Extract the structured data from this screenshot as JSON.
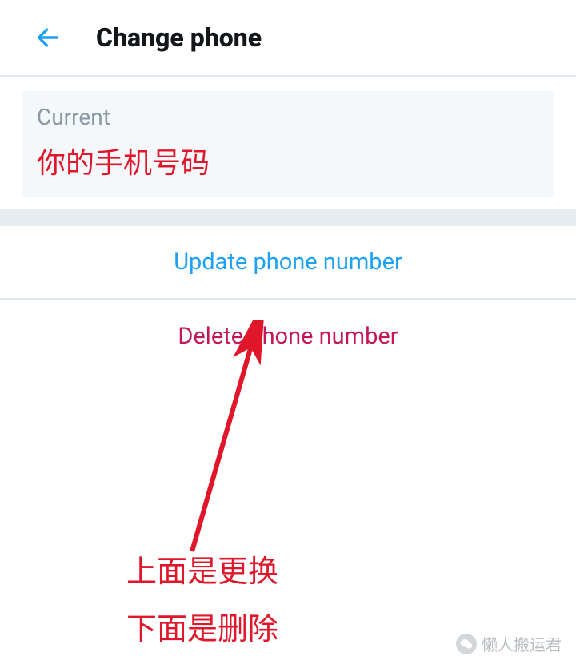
{
  "header": {
    "title": "Change phone"
  },
  "current": {
    "label": "Current",
    "value": "你的手机号码"
  },
  "actions": {
    "update": "Update phone number",
    "delete": "Delete phone number"
  },
  "annotation": {
    "line1": "上面是更换",
    "line2": "下面是删除"
  },
  "watermark": {
    "text": "懒人搬运君"
  },
  "colors": {
    "accent": "#1da1f2",
    "danger": "#c2185b",
    "annotation": "#e0162b"
  }
}
